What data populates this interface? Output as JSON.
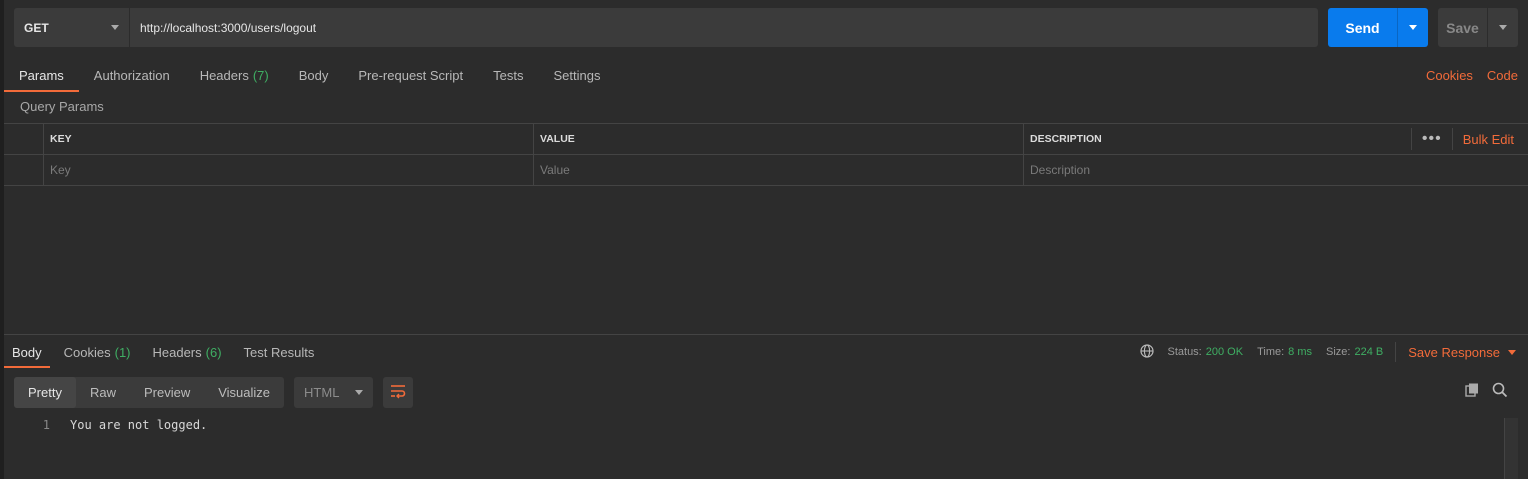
{
  "request": {
    "method": "GET",
    "url": "http://localhost:3000/users/logout",
    "send_label": "Send",
    "save_label": "Save"
  },
  "request_tabs": [
    {
      "label": "Params",
      "count": ""
    },
    {
      "label": "Authorization",
      "count": ""
    },
    {
      "label": "Headers",
      "count": "(7)"
    },
    {
      "label": "Body",
      "count": ""
    },
    {
      "label": "Pre-request Script",
      "count": ""
    },
    {
      "label": "Tests",
      "count": ""
    },
    {
      "label": "Settings",
      "count": ""
    }
  ],
  "request_links": {
    "cookies": "Cookies",
    "code": "Code"
  },
  "params": {
    "section_title": "Query Params",
    "columns": {
      "key": "KEY",
      "value": "VALUE",
      "description": "DESCRIPTION"
    },
    "bulk_edit": "Bulk Edit",
    "placeholders": {
      "key": "Key",
      "value": "Value",
      "description": "Description"
    }
  },
  "response_tabs": [
    {
      "label": "Body",
      "count": ""
    },
    {
      "label": "Cookies",
      "count": "(1)"
    },
    {
      "label": "Headers",
      "count": "(6)"
    },
    {
      "label": "Test Results",
      "count": ""
    }
  ],
  "response_meta": {
    "status_label": "Status:",
    "status_value": "200 OK",
    "time_label": "Time:",
    "time_value": "8 ms",
    "size_label": "Size:",
    "size_value": "224 B",
    "save_response": "Save Response"
  },
  "format": {
    "modes": [
      "Pretty",
      "Raw",
      "Preview",
      "Visualize"
    ],
    "language": "HTML"
  },
  "body_lines": [
    {
      "no": "1",
      "text": "You are not logged."
    }
  ],
  "colors": {
    "accent": "#f26b3a",
    "send": "#097bed",
    "status_ok": "#3fae63"
  }
}
